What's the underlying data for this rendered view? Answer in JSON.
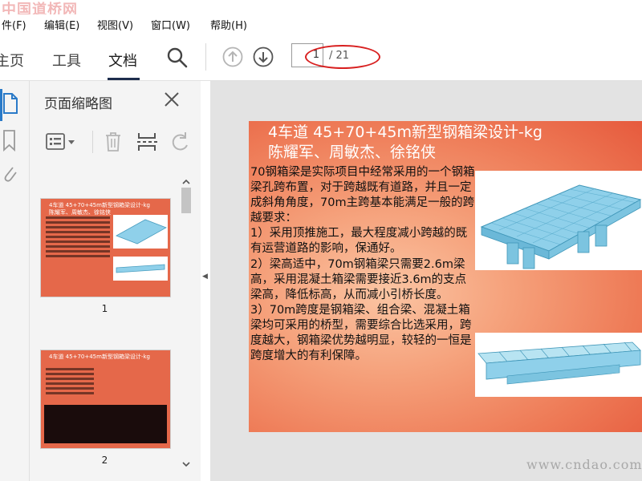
{
  "app": {
    "watermark_top": "中国道桥网",
    "watermark_bottom": "www.cndao.com"
  },
  "menu": [
    {
      "label": "件(F)"
    },
    {
      "label": "编辑(E)"
    },
    {
      "label": "视图(V)"
    },
    {
      "label": "窗口(W)"
    },
    {
      "label": "帮助(H)"
    }
  ],
  "tabs": [
    {
      "label": "主页"
    },
    {
      "label": "工具"
    },
    {
      "label": "文档"
    }
  ],
  "pager": {
    "current": "1",
    "total": "/ 21"
  },
  "thumbnails_panel": {
    "title": "页面缩略图",
    "items": [
      {
        "page": "1",
        "mini_title": "4车道 45+70+45m新型钢箱梁设计-kg\n陈耀军、周敏杰、徐铭侠"
      },
      {
        "page": "2",
        "mini_title": "4车道 45+70+45m新型钢箱梁设计-kg"
      }
    ]
  },
  "slide": {
    "title_line1": "4车道 45+70+45m新型钢箱梁设计-kg",
    "title_line2": "陈耀军、周敏杰、徐铭侠",
    "paragraphs": [
      "70钢箱梁是实际项目中经常采用的一个钢箱梁孔跨布置，对于跨越既有道路，并且一定成斜角角度，70m主跨基本能满足一般的跨越要求：",
      "1）采用顶推施工，最大程度减小跨越的既有运营道路的影响，保通好。",
      "2）梁高适中，70m钢箱梁只需要2.6m梁高，采用混凝土箱梁需要接近3.6m的支点梁高，降低标高，从而减小引桥长度。",
      "3）70m跨度是钢箱梁、组合梁、混凝土箱梁均可采用的桥型，需要综合比选采用，跨度越大，钢箱梁优势越明显，较轻的一恒是跨度增大的有利保障。"
    ]
  },
  "colors": {
    "slide_bg": "#ee7a56",
    "annotation": "#d82020",
    "accent": "#2a7ac8",
    "bridge": "#8fd0ea"
  }
}
